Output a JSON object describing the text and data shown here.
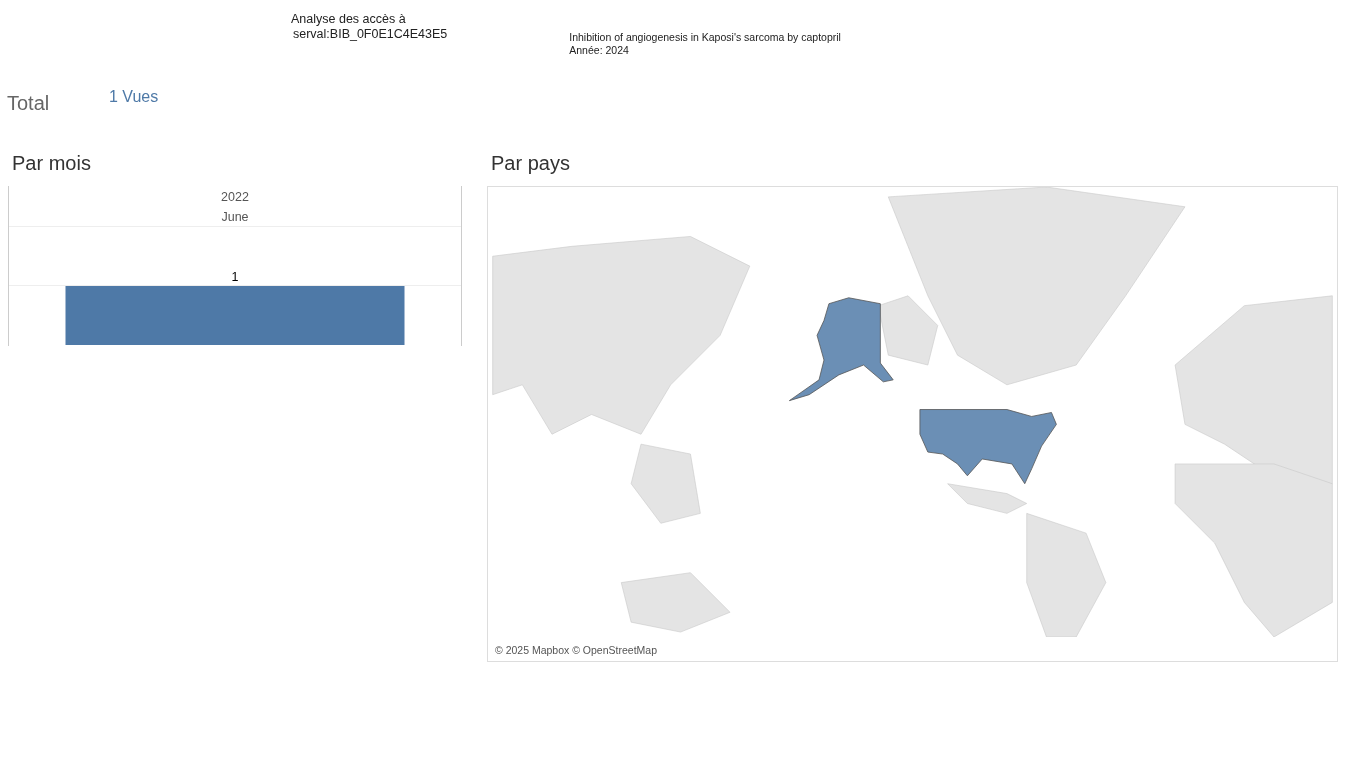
{
  "header": {
    "title_line_1": "Analyse des accès à",
    "title_line_2": "serval:BIB_0F0E1C4E43E5",
    "document_title": "Inhibition of angiogenesis in Kaposi's sarcoma by captopril",
    "document_year": "Année: 2024"
  },
  "total": {
    "label": "Total",
    "value": "1 Vues"
  },
  "by_month": {
    "title": "Par mois",
    "year": "2022",
    "months": [
      {
        "month": "June",
        "count": "1"
      }
    ]
  },
  "by_country": {
    "title": "Par pays",
    "attribution": "© 2025 Mapbox © OpenStreetMap"
  }
}
